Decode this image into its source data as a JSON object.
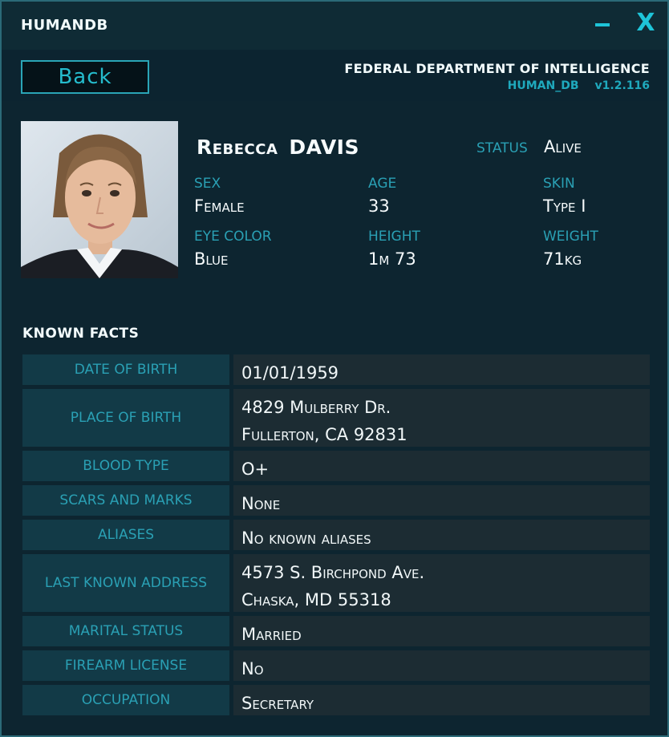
{
  "app": {
    "title": "HUMANDB",
    "minimize": "–",
    "close": "X"
  },
  "header": {
    "back_label": "Back",
    "org": "FEDERAL DEPARTMENT OF INTELLIGENCE",
    "db": "HUMAN_DB",
    "version": "v1.2.116"
  },
  "profile": {
    "first_name": "Rebecca",
    "last_name": "DAVIS",
    "status_label": "STATUS",
    "status_value": "Alive",
    "sex_label": "SEX",
    "sex": "Female",
    "age_label": "AGE",
    "age": "33",
    "skin_label": "SKIN",
    "skin": "Type I",
    "eye_label": "EYE COLOR",
    "eye": "Blue",
    "height_label": "HEIGHT",
    "height": "1m 73",
    "weight_label": "WEIGHT",
    "weight": "71kg"
  },
  "facts": {
    "heading": "KNOWN  FACTS",
    "rows": [
      {
        "label": "DATE OF BIRTH",
        "lines": [
          "01/01/1959"
        ]
      },
      {
        "label": "PLACE OF BIRTH",
        "lines": [
          "4829 Mulberry Dr.",
          "Fullerton, CA 92831"
        ]
      },
      {
        "label": "BLOOD TYPE",
        "lines": [
          "O+"
        ]
      },
      {
        "label": "SCARS AND MARKS",
        "lines": [
          "None"
        ]
      },
      {
        "label": "ALIASES",
        "lines": [
          "No known aliases"
        ]
      },
      {
        "label": "LAST KNOWN ADDRESS",
        "lines": [
          "4573 S. Birchpond Ave.",
          "Chaska, MD 55318"
        ]
      },
      {
        "label": "MARITAL STATUS",
        "lines": [
          "Married"
        ]
      },
      {
        "label": "FIREARM LICENSE",
        "lines": [
          "No"
        ]
      },
      {
        "label": "OCCUPATION",
        "lines": [
          "Secretary"
        ]
      }
    ]
  },
  "colors": {
    "accent": "#1ec4d8",
    "label": "#2aa0b4",
    "bg": "#0d2530"
  }
}
